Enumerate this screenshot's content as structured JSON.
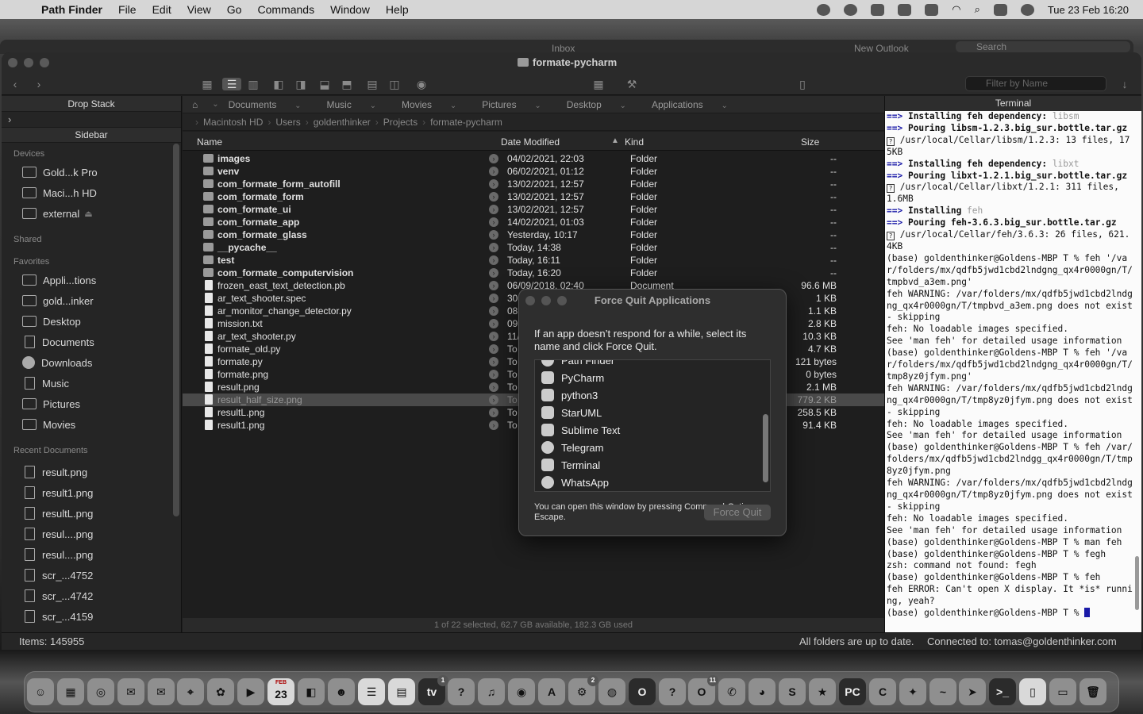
{
  "menubar": {
    "app": "Path Finder",
    "items": [
      "File",
      "Edit",
      "View",
      "Go",
      "Commands",
      "Window",
      "Help"
    ],
    "clock": "Tue 23 Feb  16:20"
  },
  "background_window": {
    "title": "Inbox",
    "new_outlook": "New Outlook",
    "search_placeholder": "Search"
  },
  "window": {
    "title": "formate-pycharm",
    "filter_placeholder": "Filter by Name"
  },
  "left_panel": {
    "drop_stack": "Drop Stack",
    "sidebar_title": "Sidebar",
    "sections": {
      "devices": "Devices",
      "shared": "Shared",
      "favorites": "Favorites",
      "recent": "Recent Documents"
    },
    "devices": [
      "Gold...k Pro",
      "Maci...h HD",
      "external"
    ],
    "favorites": [
      "Appli...tions",
      "gold...inker",
      "Desktop",
      "Documents",
      "Downloads",
      "Music",
      "Pictures",
      "Movies"
    ],
    "recent": [
      "result.png",
      "result1.png",
      "resultL.png",
      "resul....png",
      "resul....png",
      "scr_...4752",
      "scr_...4742",
      "scr_...4159"
    ]
  },
  "favbar": [
    "Documents",
    "Music",
    "Movies",
    "Pictures",
    "Desktop",
    "Applications"
  ],
  "breadcrumb": [
    "Macintosh HD",
    "Users",
    "goldenthinker",
    "Projects",
    "formate-pycharm"
  ],
  "columns": {
    "name": "Name",
    "date": "Date Modified",
    "kind": "Kind",
    "size": "Size"
  },
  "files": [
    {
      "name": "images",
      "date": "04/02/2021, 22:03",
      "kind": "Folder",
      "size": "--",
      "folder": true
    },
    {
      "name": "venv",
      "date": "06/02/2021, 01:12",
      "kind": "Folder",
      "size": "--",
      "folder": true
    },
    {
      "name": "com_formate_form_autofill",
      "date": "13/02/2021, 12:57",
      "kind": "Folder",
      "size": "--",
      "folder": true
    },
    {
      "name": "com_formate_form",
      "date": "13/02/2021, 12:57",
      "kind": "Folder",
      "size": "--",
      "folder": true
    },
    {
      "name": "com_formate_ui",
      "date": "13/02/2021, 12:57",
      "kind": "Folder",
      "size": "--",
      "folder": true
    },
    {
      "name": "com_formate_app",
      "date": "14/02/2021, 01:03",
      "kind": "Folder",
      "size": "--",
      "folder": true
    },
    {
      "name": "com_formate_glass",
      "date": "Yesterday, 10:17",
      "kind": "Folder",
      "size": "--",
      "folder": true
    },
    {
      "name": "__pycache__",
      "date": "Today, 14:38",
      "kind": "Folder",
      "size": "--",
      "folder": true
    },
    {
      "name": "test",
      "date": "Today, 16:11",
      "kind": "Folder",
      "size": "--",
      "folder": true
    },
    {
      "name": "com_formate_computervision",
      "date": "Today, 16:20",
      "kind": "Folder",
      "size": "--",
      "folder": true
    },
    {
      "name": "frozen_east_text_detection.pb",
      "date": "06/09/2018, 02:40",
      "kind": "Document",
      "size": "96.6 MB",
      "folder": false
    },
    {
      "name": "ar_text_shooter.spec",
      "date": "30",
      "kind": "",
      "size": "1 KB",
      "folder": false
    },
    {
      "name": "ar_monitor_change_detector.py",
      "date": "08",
      "kind": "",
      "size": "1.1 KB",
      "folder": false
    },
    {
      "name": "mission.txt",
      "date": "09",
      "kind": "",
      "size": "2.8 KB",
      "folder": false
    },
    {
      "name": "ar_text_shooter.py",
      "date": "11/",
      "kind": "",
      "size": "10.3 KB",
      "folder": false
    },
    {
      "name": "formate_old.py",
      "date": "To",
      "kind": "",
      "size": "4.7 KB",
      "folder": false
    },
    {
      "name": "formate.py",
      "date": "To",
      "kind": "",
      "size": "121 bytes",
      "folder": false
    },
    {
      "name": "formate.png",
      "date": "To",
      "kind": "",
      "size": "0 bytes",
      "folder": false
    },
    {
      "name": "result.png",
      "date": "To",
      "kind": "",
      "size": "2.1 MB",
      "folder": false
    },
    {
      "name": "result_half_size.png",
      "date": "To",
      "kind": "",
      "size": "779.2 KB",
      "folder": false,
      "selected": true
    },
    {
      "name": "resultL.png",
      "date": "To",
      "kind": "",
      "size": "258.5 KB",
      "folder": false
    },
    {
      "name": "result1.png",
      "date": "To",
      "kind": "",
      "size": "91.4 KB",
      "folder": false
    }
  ],
  "file_status": "1 of 22 selected, 62.7 GB available, 182.3 GB used",
  "terminal": {
    "title": "Terminal",
    "lines": [
      [
        {
          "t": "==> ",
          "c": "arrow"
        },
        {
          "t": "Installing feh dependency: ",
          "c": "b"
        },
        {
          "t": "libsm",
          "c": "dep"
        }
      ],
      [
        {
          "t": "==> ",
          "c": "arrow"
        },
        {
          "t": "Pouring libsm-1.2.3.big_sur.bottle.tar.gz",
          "c": "b"
        }
      ],
      [
        {
          "t": "?",
          "c": "q"
        },
        {
          "t": " /usr/local/Cellar/libsm/1.2.3: 13 files, 175KB",
          "c": ""
        }
      ],
      [
        {
          "t": "==> ",
          "c": "arrow"
        },
        {
          "t": "Installing feh dependency: ",
          "c": "b"
        },
        {
          "t": "libxt",
          "c": "dep"
        }
      ],
      [
        {
          "t": "==> ",
          "c": "arrow"
        },
        {
          "t": "Pouring libxt-1.2.1.big_sur.bottle.tar.gz",
          "c": "b"
        }
      ],
      [
        {
          "t": "?",
          "c": "q"
        },
        {
          "t": " /usr/local/Cellar/libxt/1.2.1: 311 files, 1.6MB",
          "c": ""
        }
      ],
      [
        {
          "t": "==> ",
          "c": "arrow"
        },
        {
          "t": "Installing ",
          "c": "b"
        },
        {
          "t": "feh",
          "c": "dep"
        }
      ],
      [
        {
          "t": "==> ",
          "c": "arrow"
        },
        {
          "t": "Pouring feh-3.6.3.big_sur.bottle.tar.gz",
          "c": "b"
        }
      ],
      [
        {
          "t": "?",
          "c": "q"
        },
        {
          "t": " /usr/local/Cellar/feh/3.6.3: 26 files, 621.4KB",
          "c": ""
        }
      ],
      [
        {
          "t": "(base) goldenthinker@Goldens-MBP T % feh '/var/folders/mx/qdfb5jwd1cbd2lndgng_qx4r0000gn/T/tmpbvd_a3em.png'",
          "c": ""
        }
      ],
      [
        {
          "t": "feh WARNING: /var/folders/mx/qdfb5jwd1cbd2lndgng_qx4r0000gn/T/tmpbvd_a3em.png does not exist - skipping",
          "c": ""
        }
      ],
      [
        {
          "t": "feh: No loadable images specified.",
          "c": ""
        }
      ],
      [
        {
          "t": "See 'man feh' for detailed usage information",
          "c": ""
        }
      ],
      [
        {
          "t": "(base) goldenthinker@Goldens-MBP T % feh '/var/folders/mx/qdfb5jwd1cbd2lndgng_qx4r0000gn/T/tmp8yz0jfym.png'",
          "c": ""
        }
      ],
      [
        {
          "t": "feh WARNING: /var/folders/mx/qdfb5jwd1cbd2lndgng_qx4r0000gn/T/tmp8yz0jfym.png does not exist - skipping",
          "c": ""
        }
      ],
      [
        {
          "t": "feh: No loadable images specified.",
          "c": ""
        }
      ],
      [
        {
          "t": "See 'man feh' for detailed usage information",
          "c": ""
        }
      ],
      [
        {
          "t": "(base) goldenthinker@Goldens-MBP T % feh /var/folders/mx/qdfb5jwd1cbd2lndgg_qx4r0000gn/T/tmp8yz0jfym.png",
          "c": ""
        }
      ],
      [
        {
          "t": "feh WARNING: /var/folders/mx/qdfb5jwd1cbd2lndgng_qx4r0000gn/T/tmp8yz0jfym.png does not exist - skipping",
          "c": ""
        }
      ],
      [
        {
          "t": "feh: No loadable images specified.",
          "c": ""
        }
      ],
      [
        {
          "t": "See 'man feh' for detailed usage information",
          "c": ""
        }
      ],
      [
        {
          "t": "(base) goldenthinker@Goldens-MBP T % man feh",
          "c": ""
        }
      ],
      [
        {
          "t": "(base) goldenthinker@Goldens-MBP T % fegh",
          "c": ""
        }
      ],
      [
        {
          "t": "zsh: command not found: fegh",
          "c": ""
        }
      ],
      [
        {
          "t": "(base) goldenthinker@Goldens-MBP T % feh",
          "c": ""
        }
      ],
      [
        {
          "t": "feh ERROR: Can't open X display. It *is* running, yeah?",
          "c": ""
        }
      ],
      [
        {
          "t": "(base) goldenthinker@Goldens-MBP T % ",
          "c": ""
        },
        {
          "t": "",
          "c": "cursor"
        }
      ]
    ]
  },
  "status": {
    "items": "Items: 145955",
    "sync": "All folders are up to date.",
    "connected": "Connected to: tomas@goldenthinker.com"
  },
  "force_quit": {
    "title": "Force Quit Applications",
    "description": "If an app doesn’t respond for a while, select its name and click Force Quit.",
    "apps": [
      {
        "name": "Path Finder",
        "icon": "path-finder-icon"
      },
      {
        "name": "PyCharm",
        "icon": "pycharm-icon"
      },
      {
        "name": "python3",
        "icon": "document-icon"
      },
      {
        "name": "StarUML",
        "icon": "staruml-icon"
      },
      {
        "name": "Sublime Text",
        "icon": "sublime-icon"
      },
      {
        "name": "Telegram",
        "icon": "telegram-icon"
      },
      {
        "name": "Terminal",
        "icon": "terminal-icon"
      },
      {
        "name": "WhatsApp",
        "icon": "whatsapp-icon"
      }
    ],
    "hint": "You can open this window by pressing Command-Option-Escape.",
    "button": "Force Quit"
  },
  "dock": [
    {
      "name": "finder-icon",
      "glyph": "☺"
    },
    {
      "name": "launchpad-icon",
      "glyph": "▦"
    },
    {
      "name": "safari-icon",
      "glyph": "◎"
    },
    {
      "name": "messages-icon",
      "glyph": "✉"
    },
    {
      "name": "mail-icon",
      "glyph": "✉"
    },
    {
      "name": "maps-icon",
      "glyph": "⌖"
    },
    {
      "name": "photos-icon",
      "glyph": "✿"
    },
    {
      "name": "facetime-icon",
      "glyph": "▶"
    },
    {
      "name": "calendar-icon",
      "glyph": "23",
      "sub": "FEB"
    },
    {
      "name": "preview-icon",
      "glyph": "◧"
    },
    {
      "name": "contacts-icon",
      "glyph": "☻"
    },
    {
      "name": "reminders-icon",
      "glyph": "☰"
    },
    {
      "name": "notes-icon",
      "glyph": "▤"
    },
    {
      "name": "tv-icon",
      "glyph": "tv",
      "badge": "1"
    },
    {
      "name": "help-icon",
      "glyph": "?"
    },
    {
      "name": "music-icon",
      "glyph": "♫"
    },
    {
      "name": "podcasts-icon",
      "glyph": "◉"
    },
    {
      "name": "app-store-icon",
      "glyph": "A"
    },
    {
      "name": "system-preferences-icon",
      "glyph": "⚙",
      "badge": "2"
    },
    {
      "name": "chrome-icon",
      "glyph": "◍"
    },
    {
      "name": "opera-icon",
      "glyph": "O"
    },
    {
      "name": "help2-icon",
      "glyph": "?"
    },
    {
      "name": "outlook-icon",
      "glyph": "O",
      "badge": "11"
    },
    {
      "name": "whatsapp-icon",
      "glyph": "✆"
    },
    {
      "name": "path-finder-icon",
      "glyph": "◕"
    },
    {
      "name": "sublime-icon",
      "glyph": "S"
    },
    {
      "name": "staruml-icon",
      "glyph": "★"
    },
    {
      "name": "pycharm-icon",
      "glyph": "PC"
    },
    {
      "name": "cleanmymac-icon",
      "glyph": "C"
    },
    {
      "name": "instruments-icon",
      "glyph": "✦"
    },
    {
      "name": "messenger-icon",
      "glyph": "~"
    },
    {
      "name": "telegram-icon",
      "glyph": "➤"
    },
    {
      "name": "terminal-icon",
      "glyph": ">_"
    },
    {
      "name": "document-icon",
      "glyph": "▯"
    },
    {
      "name": "downloads-stack-icon",
      "glyph": "▭"
    },
    {
      "name": "trash-icon",
      "glyph": "🗑"
    }
  ]
}
